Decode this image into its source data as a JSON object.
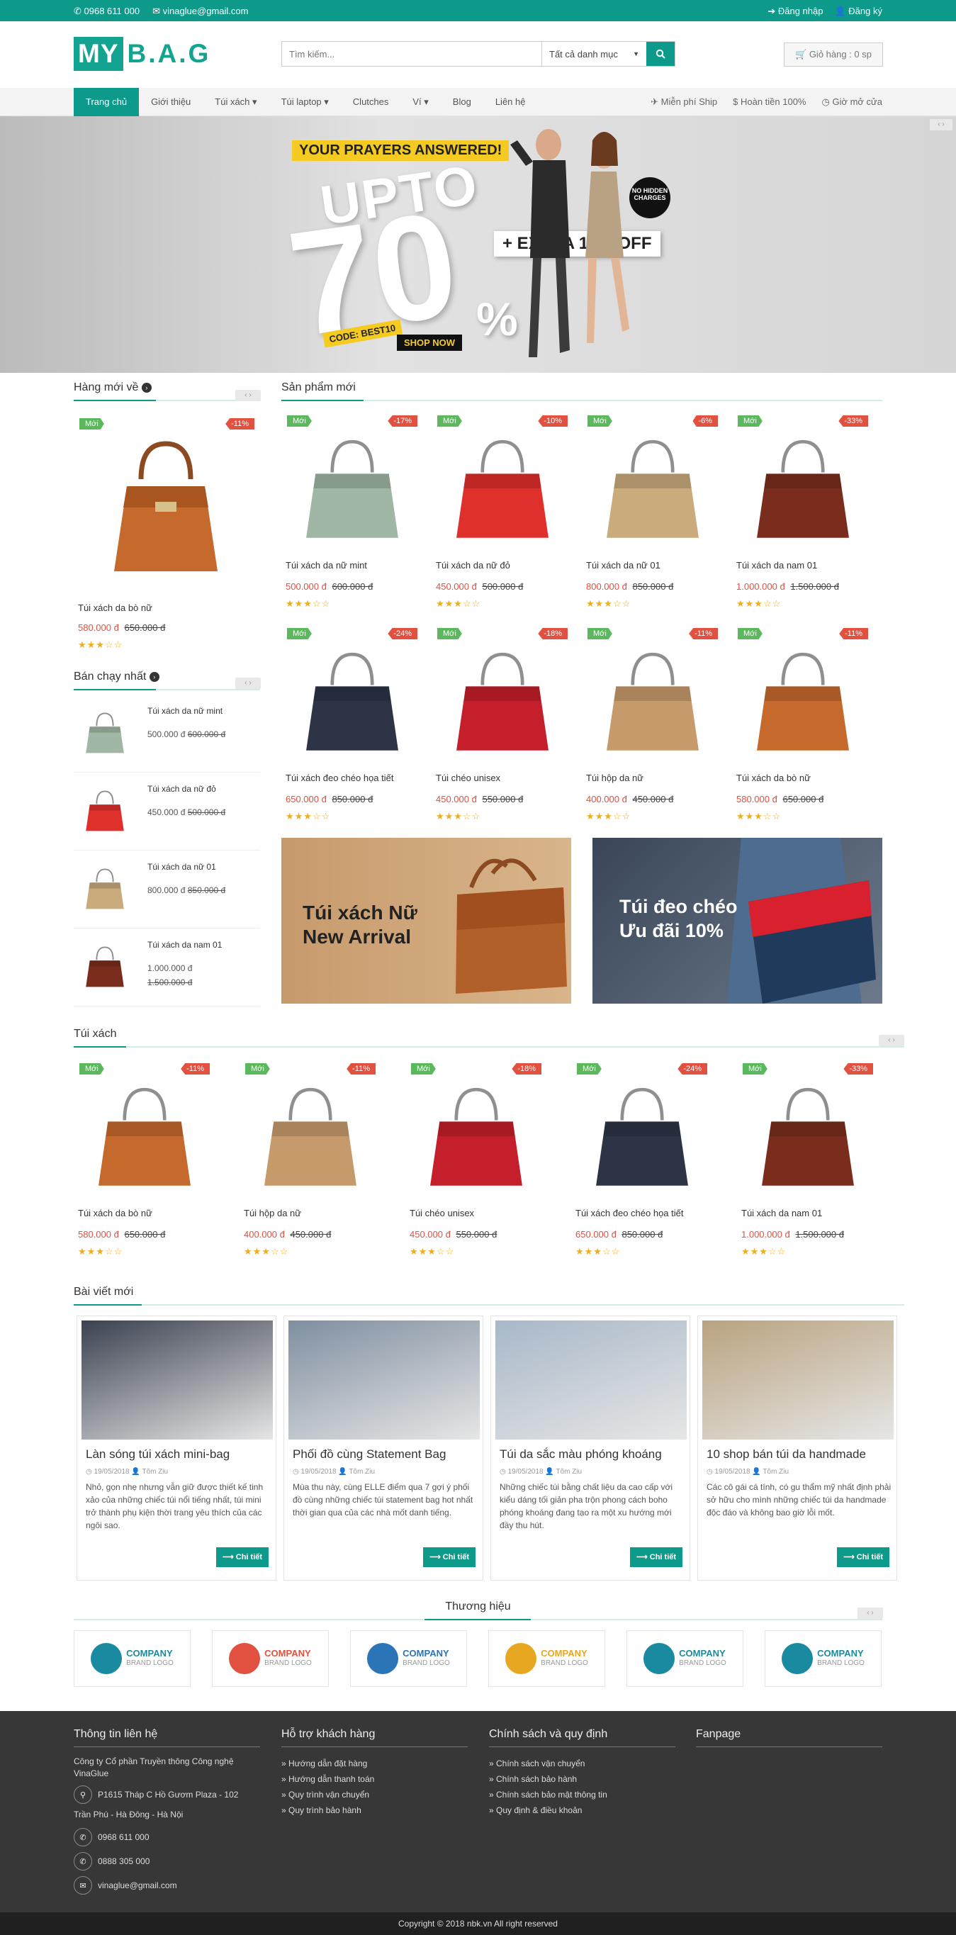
{
  "topbar": {
    "phone": "0968 611 000",
    "email": "vinaglue@gmail.com",
    "login": "Đăng nhập",
    "register": "Đăng ký"
  },
  "header": {
    "logo_box": "MY",
    "logo_text": "B.A.G",
    "search_placeholder": "Tìm kiếm...",
    "category_select": "Tất cả danh mục",
    "cart": "Giỏ hàng : 0 sp"
  },
  "nav": {
    "items": [
      "Trang chủ",
      "Giới thiệu",
      "Túi xách ▾",
      "Túi laptop ▾",
      "Clutches",
      "Ví ▾",
      "Blog",
      "Liên hệ"
    ],
    "right": [
      "✈ Miễn phí Ship",
      "$ Hoàn tiền 100%",
      "◷ Giờ mở cửa"
    ]
  },
  "banner": {
    "tagline": "YOUR PRAYERS ANSWERED!",
    "upto": "UPTO",
    "big": "70",
    "percent": "%",
    "extra": "+ EXTRA 10% OFF",
    "no_hidden": "NO HIDDEN CHARGES",
    "code": "CODE: BEST10",
    "shop": "SHOP NOW"
  },
  "sidebar": {
    "new_title": "Hàng mới về",
    "new_product": {
      "badge_new": "Mới",
      "badge_sale": "-11%",
      "name": "Túi xách da bò nữ",
      "price": "580.000 đ",
      "old": "650.000 đ"
    },
    "best_title": "Bán chạy nhất",
    "best": [
      {
        "name": "Túi xách da nữ mint",
        "price": "500.000 đ",
        "old": "600.000 đ"
      },
      {
        "name": "Túi xách da nữ đỏ",
        "price": "450.000 đ",
        "old": "500.000 đ"
      },
      {
        "name": "Túi xách da nữ 01",
        "price": "800.000 đ",
        "old": "850.000 đ"
      },
      {
        "name": "Túi xách da nam 01",
        "price": "1.000.000 đ",
        "old": "1.500.000 đ"
      }
    ]
  },
  "new_products": {
    "title": "Sản phẩm mới",
    "items": [
      {
        "badge_new": "Mới",
        "badge_sale": "-17%",
        "name": "Túi xách da nữ mint",
        "price": "500.000 đ",
        "old": "600.000 đ",
        "color": "#9fb7a4"
      },
      {
        "badge_new": "Mới",
        "badge_sale": "-10%",
        "name": "Túi xách da nữ đỏ",
        "price": "450.000 đ",
        "old": "500.000 đ",
        "color": "#e0302b"
      },
      {
        "badge_new": "Mới",
        "badge_sale": "-6%",
        "name": "Túi xách da nữ 01",
        "price": "800.000 đ",
        "old": "850.000 đ",
        "color": "#c9ab7c"
      },
      {
        "badge_new": "Mới",
        "badge_sale": "-33%",
        "name": "Túi xách da nam 01",
        "price": "1.000.000 đ",
        "old": "1.500.000 đ",
        "color": "#7a2d1c"
      },
      {
        "badge_new": "Mới",
        "badge_sale": "-24%",
        "name": "Túi xách đeo chéo họa tiết",
        "price": "650.000 đ",
        "old": "850.000 đ",
        "color": "#2c3446"
      },
      {
        "badge_new": "Mới",
        "badge_sale": "-18%",
        "name": "Túi chéo unisex",
        "price": "450.000 đ",
        "old": "550.000 đ",
        "color": "#c51f2b"
      },
      {
        "badge_new": "Mới",
        "badge_sale": "-11%",
        "name": "Túi hộp da nữ",
        "price": "400.000 đ",
        "old": "450.000 đ",
        "color": "#c79a6c"
      },
      {
        "badge_new": "Mới",
        "badge_sale": "-11%",
        "name": "Túi xách da bò nữ",
        "price": "580.000 đ",
        "old": "650.000 đ",
        "color": "#c6692c"
      }
    ]
  },
  "promos": [
    {
      "line1": "Túi xách Nữ",
      "line2": "New Arrival"
    },
    {
      "line1": "Túi đeo chéo",
      "line2": "Ưu đãi 10%"
    }
  ],
  "handbags": {
    "title": "Túi xách",
    "items": [
      {
        "badge_new": "Mới",
        "badge_sale": "-11%",
        "name": "Túi xách da bò nữ",
        "price": "580.000 đ",
        "old": "650.000 đ",
        "color": "#c6692c"
      },
      {
        "badge_new": "Mới",
        "badge_sale": "-11%",
        "name": "Túi hộp da nữ",
        "price": "400.000 đ",
        "old": "450.000 đ",
        "color": "#c79a6c"
      },
      {
        "badge_new": "Mới",
        "badge_sale": "-18%",
        "name": "Túi chéo unisex",
        "price": "450.000 đ",
        "old": "550.000 đ",
        "color": "#c51f2b"
      },
      {
        "badge_new": "Mới",
        "badge_sale": "-24%",
        "name": "Túi xách đeo chéo họa tiết",
        "price": "650.000 đ",
        "old": "850.000 đ",
        "color": "#2c3446"
      },
      {
        "badge_new": "Mới",
        "badge_sale": "-33%",
        "name": "Túi xách da nam 01",
        "price": "1.000.000 đ",
        "old": "1.500.000 đ",
        "color": "#7a2d1c"
      }
    ]
  },
  "blog": {
    "title": "Bài viết mới",
    "posts": [
      {
        "title": "Làn sóng túi xách mini-bag",
        "date": "19/05/2018",
        "author": "Tôm Ziu",
        "excerpt": "Nhỏ, gọn nhẹ nhưng vẫn giữ được thiết kế tinh xảo của những chiếc túi nổi tiếng nhất, túi mini trở thành phụ kiện thời trang yêu thích của các ngôi sao.",
        "more": "⟶ Chi tiết",
        "color": "#3a4150"
      },
      {
        "title": "Phối đồ cùng Statement Bag",
        "date": "19/05/2018",
        "author": "Tôm Ziu",
        "excerpt": "Mùa thu này, cùng ELLE điểm qua 7 gợi ý phối đồ cùng những chiếc túi statement bag hot nhất thời gian qua của các nhà mốt danh tiếng.",
        "more": "⟶ Chi tiết",
        "color": "#7f8fa0"
      },
      {
        "title": "Túi da sắc màu phóng khoáng",
        "date": "19/05/2018",
        "author": "Tôm Ziu",
        "excerpt": "Những chiếc túi bằng chất liệu da cao cấp với kiểu dáng tối giản pha trộn phong cách boho phóng khoáng đang tạo ra một xu hướng mới đầy thu hút.",
        "more": "⟶ Chi tiết",
        "color": "#a8b8c8"
      },
      {
        "title": "10 shop bán túi da handmade",
        "date": "19/05/2018",
        "author": "Tôm Ziu",
        "excerpt": "Các cô gái cá tính, có gu thẩm mỹ nhất định phải sở hữu cho mình những chiếc túi da handmade độc đáo và không bao giờ lỗi mốt.",
        "more": "⟶ Chi tiết",
        "color": "#b9a37f"
      }
    ]
  },
  "brands": {
    "title": "Thương hiệu",
    "items": [
      {
        "name": "COMPANY",
        "sub": "BRAND LOGO",
        "color": "#1a8aa0",
        "icon": "leaf-icon"
      },
      {
        "name": "COMPANY",
        "sub": "BRAND LOGO",
        "color": "#e2503f",
        "icon": "tv-icon"
      },
      {
        "name": "COMPANY",
        "sub": "BRAND LOGO",
        "color": "#2b74b8",
        "icon": "chart-icon"
      },
      {
        "name": "COMPANY",
        "sub": "BRAND LOGO",
        "color": "#e8a720",
        "icon": "rocket-icon"
      },
      {
        "name": "COMPANY",
        "sub": "BRAND LOGO",
        "color": "#1a8aa0",
        "icon": "cloud-icon"
      },
      {
        "name": "COMPANY",
        "sub": "BRAND LOGO",
        "color": "#1a8aa0",
        "icon": "leaf-icon"
      }
    ]
  },
  "footer": {
    "contact_title": "Thông tin liên hệ",
    "company": "Công ty Cổ phần Truyền thông Công nghệ VinaGlue",
    "address1": "P1615 Tháp C Hồ Gươm Plaza - 102",
    "address2": "Trần Phú - Hà Đông - Hà Nội",
    "phone1": "0968 611 000",
    "phone2": "0888 305 000",
    "email": "vinaglue@gmail.com",
    "support_title": "Hỗ trợ khách hàng",
    "support": [
      "» Hướng dẫn đặt hàng",
      "» Hướng dẫn thanh toán",
      "» Quy trình vận chuyển",
      "» Quy trình bảo hành"
    ],
    "policy_title": "Chính sách và quy định",
    "policy": [
      "» Chính sách vận chuyển",
      "» Chính sách bảo hành",
      "» Chính sách bảo mật thông tin",
      "» Quy định & điều khoản"
    ],
    "fanpage_title": "Fanpage",
    "copyright": "Copyright © 2018 nbk.vn All right reserved"
  }
}
